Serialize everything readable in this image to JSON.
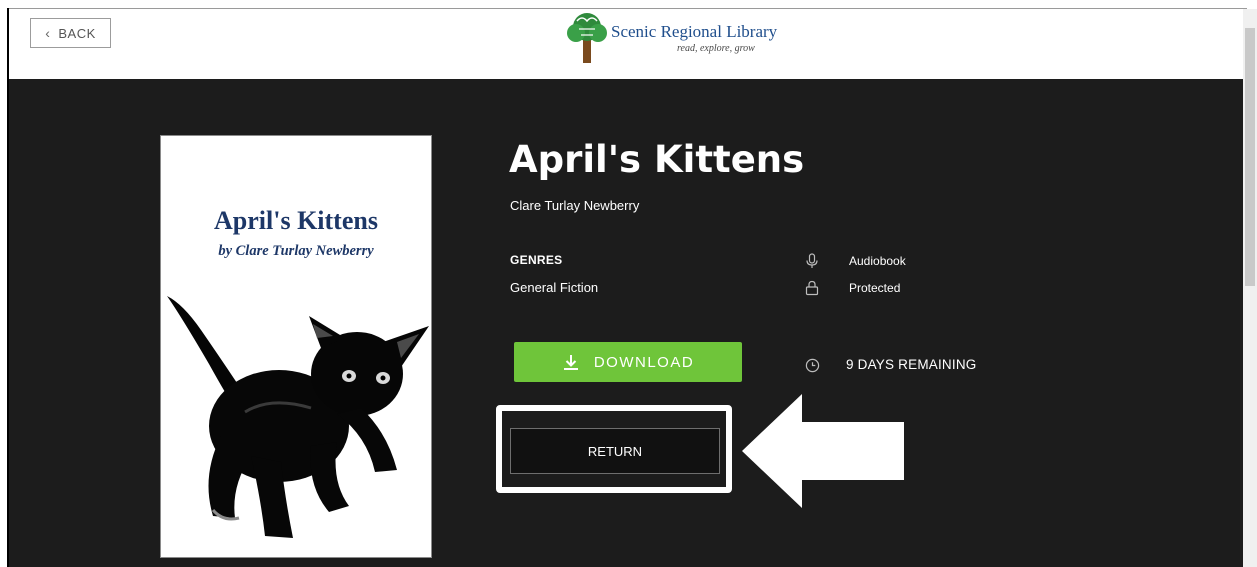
{
  "header": {
    "back_label": "BACK",
    "logo": {
      "name": "Scenic Regional Library",
      "tagline": "read, explore, grow",
      "icon": "tree-logo-icon"
    }
  },
  "book": {
    "title": "April's Kittens",
    "author": "Clare Turlay Newberry",
    "cover": {
      "title": "April's Kittens",
      "byline": "by Clare Turlay Newberry"
    },
    "genres_label": "GENRES",
    "genre": "General Fiction",
    "format": {
      "icon": "microphone-icon",
      "label": "Audiobook"
    },
    "protection": {
      "icon": "lock-icon",
      "label": "Protected"
    }
  },
  "actions": {
    "download_label": "DOWNLOAD",
    "download_icon": "download-icon",
    "return_label": "RETURN",
    "remaining_icon": "clock-icon",
    "remaining_label": "9 DAYS REMAINING"
  },
  "colors": {
    "background": "#1c1c1c",
    "download_green": "#6fc53a",
    "logo_blue": "#1f4e8c",
    "cover_text": "#1d3767"
  }
}
